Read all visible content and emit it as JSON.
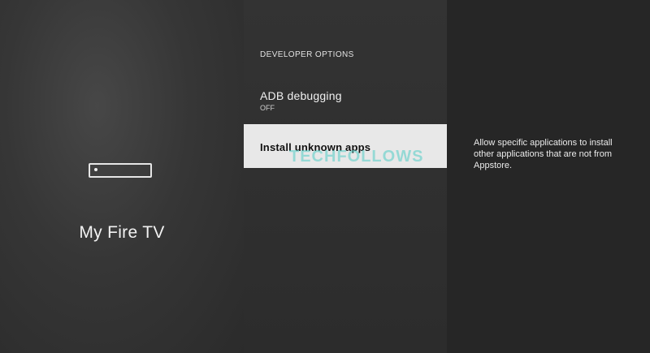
{
  "left_panel": {
    "title": "My Fire TV",
    "icon": "fire-tv-device-icon"
  },
  "menu": {
    "section_header": "DEVELOPER OPTIONS",
    "items": [
      {
        "label": "ADB debugging",
        "value": "OFF",
        "selected": false
      },
      {
        "label": "Install unknown apps",
        "selected": true
      }
    ]
  },
  "description": {
    "text": "Allow specific applications to install other applications that are not from Appstore."
  },
  "watermark": {
    "text": "TECHFOLLOWS"
  },
  "colors": {
    "selected_bg": "#e8e8e8",
    "watermark": "#5fd0c9"
  }
}
